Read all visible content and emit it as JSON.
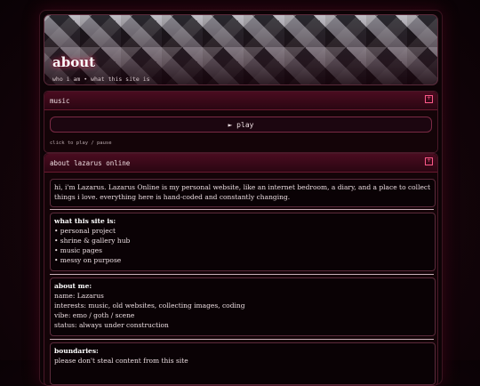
{
  "banner": {
    "title": "about",
    "subtitle": "who i am • what this site is"
  },
  "music": {
    "header": "music",
    "play_label": "► play",
    "hint": "click to play / pause"
  },
  "about": {
    "header": "about lazarus online",
    "intro": "hi, i'm Lazarus. Lazarus Online is my personal website, like an internet bedroom, a diary, and a place to collect things i love. everything here is hand-coded and constantly changing.",
    "what_title": "what this site is:",
    "what_items": [
      "• personal project",
      "• shrine & gallery hub",
      "• music pages",
      "• messy on purpose"
    ],
    "me_title": "about me:",
    "me_lines": [
      "name: Lazarus",
      "interests: music, old websites, collecting images, coding",
      "vibe: emo / goth / scene",
      "status: always under construction"
    ],
    "bounds_title": "boundaries:",
    "bounds_lines": [
      "please don't steal content from this site"
    ]
  },
  "colors": {
    "accent": "#ff5a8a",
    "header_bg": "#4a0c20",
    "page_bg": "#0d0306"
  },
  "icons": {
    "corner": "plus-box-icon"
  }
}
